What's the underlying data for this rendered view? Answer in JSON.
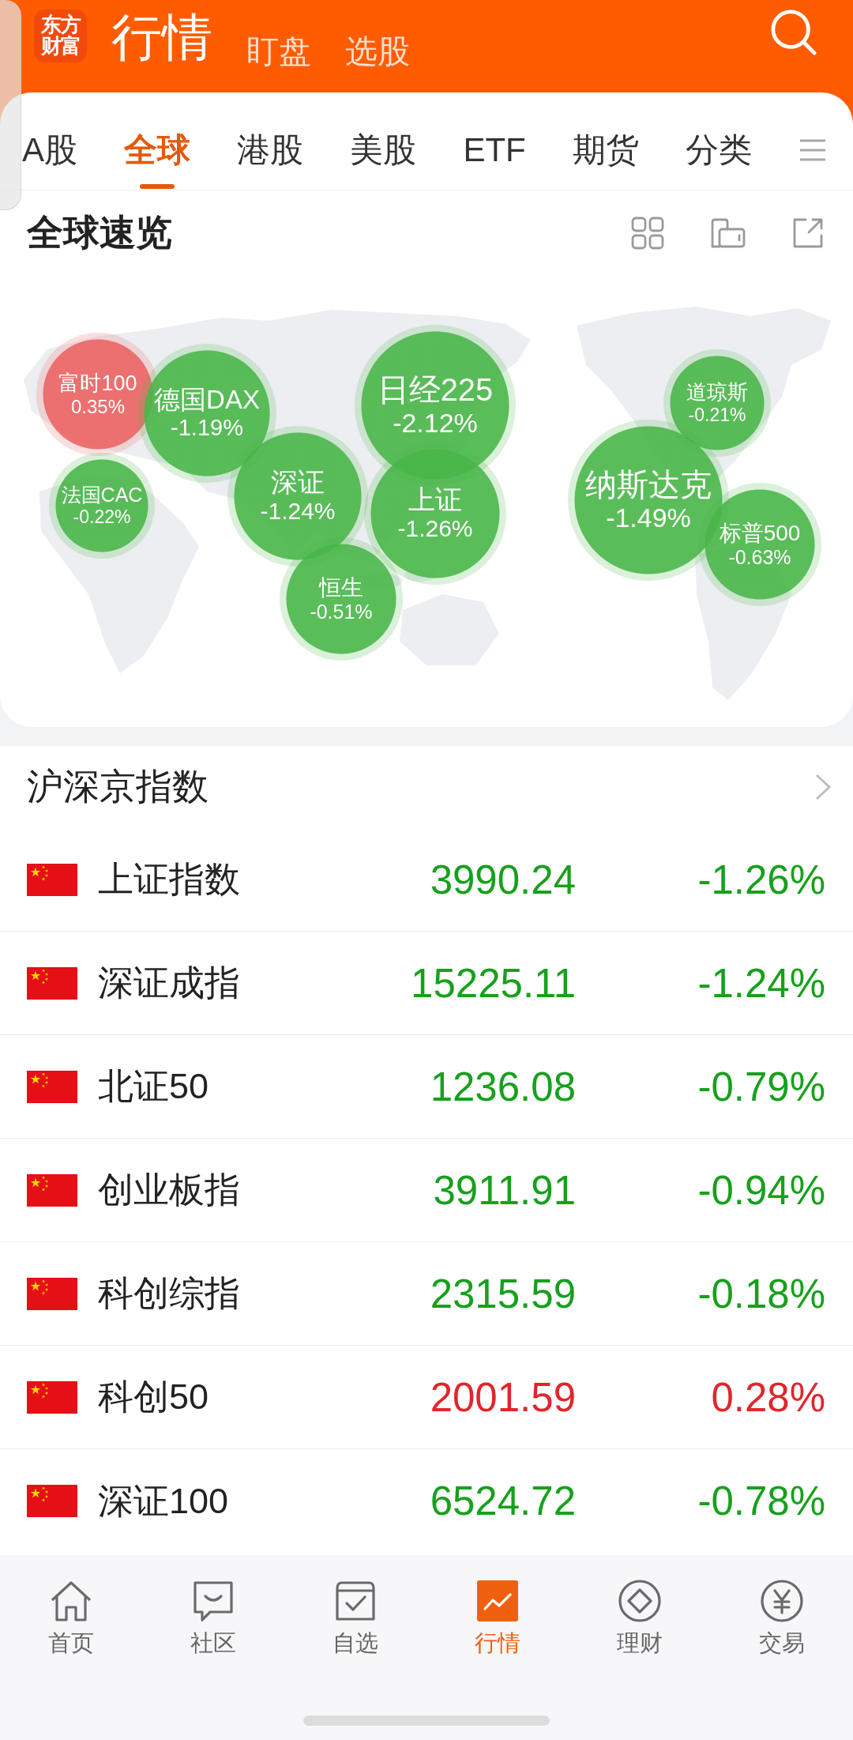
{
  "header": {
    "logo": "东方财富",
    "tabs": [
      {
        "label": "行情",
        "selected": true
      },
      {
        "label": "盯盘",
        "selected": false
      },
      {
        "label": "选股",
        "selected": false
      }
    ]
  },
  "market_tabs": [
    {
      "label": "A股",
      "selected": false
    },
    {
      "label": "全球",
      "selected": true
    },
    {
      "label": "港股",
      "selected": false
    },
    {
      "label": "美股",
      "selected": false
    },
    {
      "label": "ETF",
      "selected": false
    },
    {
      "label": "期货",
      "selected": false
    },
    {
      "label": "分类",
      "selected": false
    }
  ],
  "global_overview": {
    "title": "全球速览",
    "bubbles": [
      {
        "name": "富时100",
        "change": "0.35%",
        "rising": true
      },
      {
        "name": "德国DAX",
        "change": "-1.19%",
        "rising": false
      },
      {
        "name": "法国CAC",
        "change": "-0.22%",
        "rising": false
      },
      {
        "name": "深证",
        "change": "-1.24%",
        "rising": false
      },
      {
        "name": "恒生",
        "change": "-0.51%",
        "rising": false
      },
      {
        "name": "日经225",
        "change": "-2.12%",
        "rising": false
      },
      {
        "name": "上证",
        "change": "-1.26%",
        "rising": false
      },
      {
        "name": "纳斯达克",
        "change": "-1.49%",
        "rising": false
      },
      {
        "name": "道琼斯",
        "change": "-0.21%",
        "rising": false
      },
      {
        "name": "标普500",
        "change": "-0.63%",
        "rising": false
      }
    ]
  },
  "index_list": {
    "title": "沪深京指数",
    "rows": [
      {
        "name": "上证指数",
        "price": "3990.24",
        "change": "-1.26%",
        "rising": false
      },
      {
        "name": "深证成指",
        "price": "15225.11",
        "change": "-1.24%",
        "rising": false
      },
      {
        "name": "北证50",
        "price": "1236.08",
        "change": "-0.79%",
        "rising": false
      },
      {
        "name": "创业板指",
        "price": "3911.91",
        "change": "-0.94%",
        "rising": false
      },
      {
        "name": "科创综指",
        "price": "2315.59",
        "change": "-0.18%",
        "rising": false
      },
      {
        "name": "科创50",
        "price": "2001.59",
        "change": "0.28%",
        "rising": true
      },
      {
        "name": "深证100",
        "price": "6524.72",
        "change": "-0.78%",
        "rising": false
      }
    ]
  },
  "bottom_nav": [
    {
      "label": "首页",
      "selected": false
    },
    {
      "label": "社区",
      "selected": false
    },
    {
      "label": "自选",
      "selected": false
    },
    {
      "label": "行情",
      "selected": true
    },
    {
      "label": "理财",
      "selected": false
    },
    {
      "label": "交易",
      "selected": false
    }
  ]
}
